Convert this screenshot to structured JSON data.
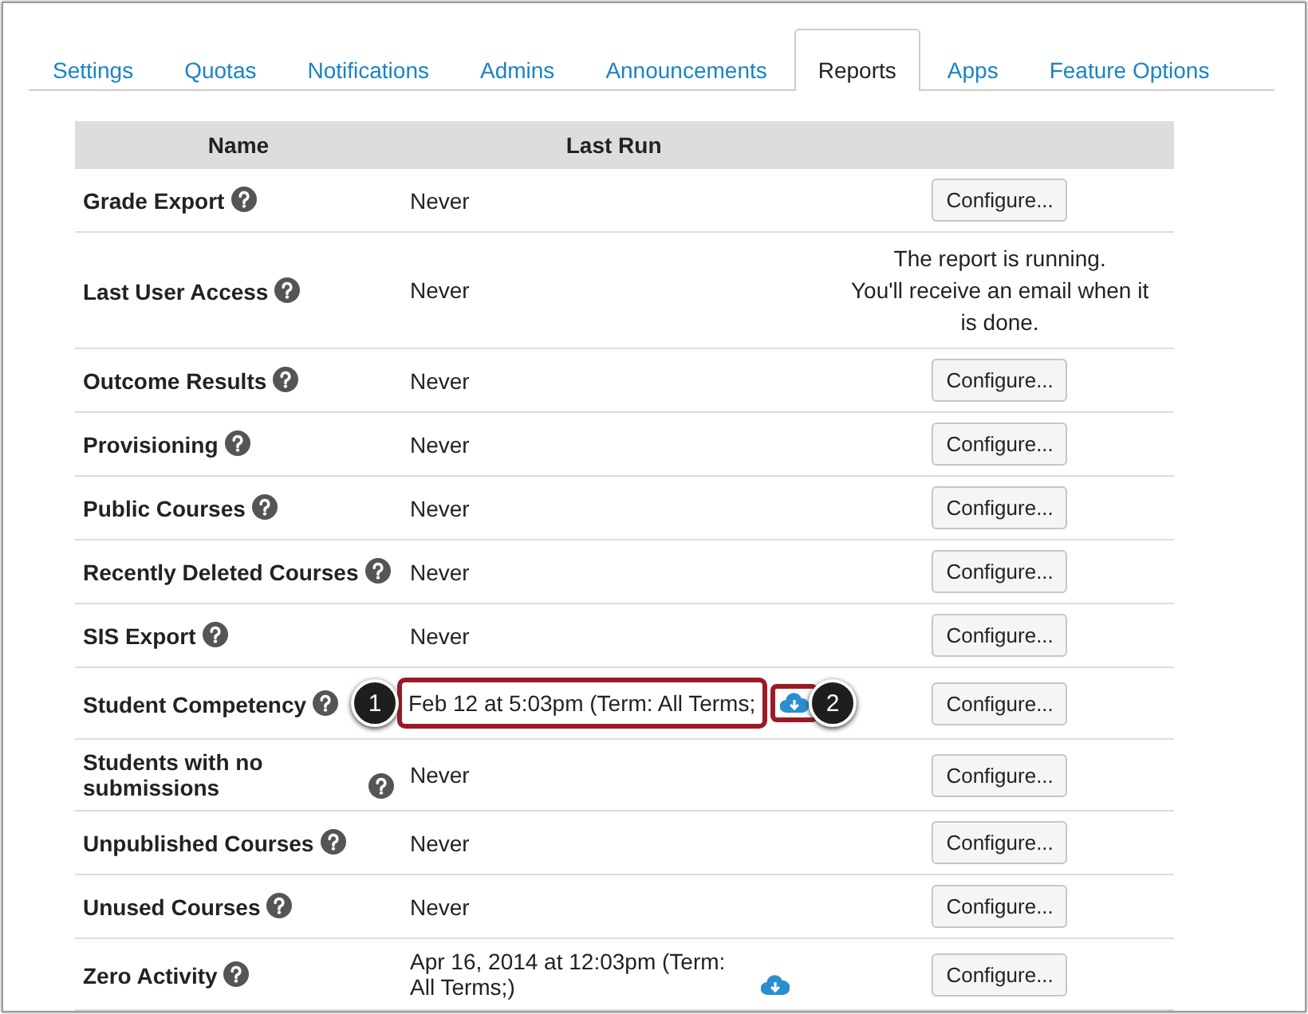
{
  "tabs": [
    {
      "label": "Settings",
      "selected": false
    },
    {
      "label": "Quotas",
      "selected": false
    },
    {
      "label": "Notifications",
      "selected": false
    },
    {
      "label": "Admins",
      "selected": false
    },
    {
      "label": "Announcements",
      "selected": false
    },
    {
      "label": "Reports",
      "selected": true
    },
    {
      "label": "Apps",
      "selected": false
    },
    {
      "label": "Feature Options",
      "selected": false
    }
  ],
  "table": {
    "columns": [
      "Name",
      "Last Run"
    ],
    "rows": [
      {
        "name": "Grade Export",
        "last_run": "Never",
        "download": false,
        "action": {
          "kind": "button",
          "label": "Configure..."
        }
      },
      {
        "name": "Last User Access",
        "last_run": "Never",
        "download": false,
        "action": {
          "kind": "message",
          "lines": [
            "The report is running.",
            "You'll receive an email when it is done."
          ]
        }
      },
      {
        "name": "Outcome Results",
        "last_run": "Never",
        "download": false,
        "action": {
          "kind": "button",
          "label": "Configure..."
        }
      },
      {
        "name": "Provisioning",
        "last_run": "Never",
        "download": false,
        "action": {
          "kind": "button",
          "label": "Configure..."
        }
      },
      {
        "name": "Public Courses",
        "last_run": "Never",
        "download": false,
        "action": {
          "kind": "button",
          "label": "Configure..."
        }
      },
      {
        "name": "Recently Deleted Courses",
        "last_run": "Never",
        "download": false,
        "action": {
          "kind": "button",
          "label": "Configure..."
        }
      },
      {
        "name": "SIS Export",
        "last_run": "Never",
        "download": false,
        "action": {
          "kind": "button",
          "label": "Configure..."
        }
      },
      {
        "name": "Student Competency",
        "last_run": "Feb 12 at 5:03pm (Term: All Terms;",
        "download": true,
        "callouts": {
          "run": "1",
          "download": "2"
        },
        "action": {
          "kind": "button",
          "label": "Configure..."
        }
      },
      {
        "name": "Students with no submissions",
        "last_run": "Never",
        "download": false,
        "action": {
          "kind": "button",
          "label": "Configure..."
        }
      },
      {
        "name": "Unpublished Courses",
        "last_run": "Never",
        "download": false,
        "action": {
          "kind": "button",
          "label": "Configure..."
        }
      },
      {
        "name": "Unused Courses",
        "last_run": "Never",
        "download": false,
        "action": {
          "kind": "button",
          "label": "Configure..."
        }
      },
      {
        "name": "Zero Activity",
        "last_run": "Apr 16, 2014 at 12:03pm (Term: All Terms;)",
        "download": true,
        "action": {
          "kind": "button",
          "label": "Configure..."
        }
      }
    ]
  }
}
